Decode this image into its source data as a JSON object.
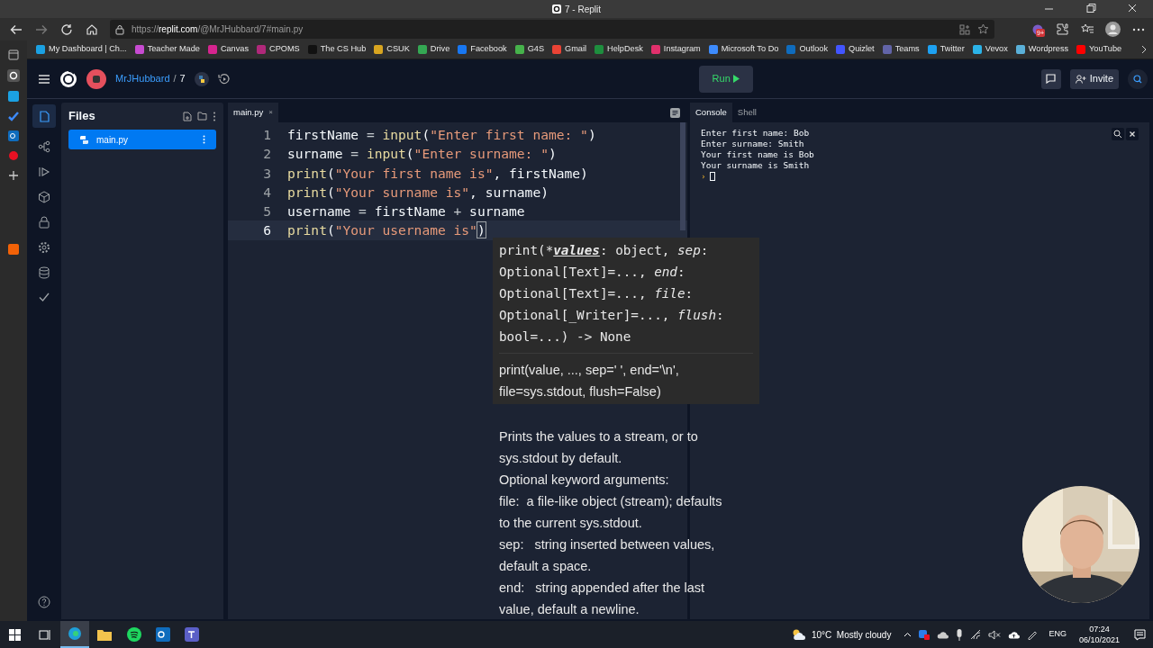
{
  "browser": {
    "tab_title": "7 - Replit",
    "url": {
      "scheme": "https://",
      "host": "replit.com",
      "path": "/@MrJHubbard/7#main.py"
    },
    "extension_badge": "9+",
    "bookmarks": [
      {
        "label": "My Dashboard | Ch...",
        "color": "#1ba1e2"
      },
      {
        "label": "Teacher Made",
        "color": "#c74bd1"
      },
      {
        "label": "Canvas",
        "color": "#d6248f"
      },
      {
        "label": "CPOMS",
        "color": "#b0287a"
      },
      {
        "label": "The CS Hub",
        "color": "#111111"
      },
      {
        "label": "CSUK",
        "color": "#d8a520"
      },
      {
        "label": "Drive",
        "color": "#34a853"
      },
      {
        "label": "Facebook",
        "color": "#1877f2"
      },
      {
        "label": "G4S",
        "color": "#46b24b"
      },
      {
        "label": "Gmail",
        "color": "#ea4335"
      },
      {
        "label": "HelpDesk",
        "color": "#1e8e3e"
      },
      {
        "label": "Instagram",
        "color": "#e1306c"
      },
      {
        "label": "Microsoft To Do",
        "color": "#3d8bfd"
      },
      {
        "label": "Outlook",
        "color": "#0f6cbd"
      },
      {
        "label": "Quizlet",
        "color": "#4255ff"
      },
      {
        "label": "Teams",
        "color": "#6264a7"
      },
      {
        "label": "Twitter",
        "color": "#1da1f2"
      },
      {
        "label": "Vevox",
        "color": "#2bb3e8"
      },
      {
        "label": "Wordpress",
        "color": "#5ab0d8"
      },
      {
        "label": "YouTube",
        "color": "#ff0000"
      }
    ]
  },
  "replit": {
    "user": "MrJHubbard",
    "separator": "/",
    "repl": "7",
    "run_label": "Run",
    "invite_label": "Invite",
    "files_title": "Files",
    "files": [
      {
        "name": "main.py",
        "selected": true
      }
    ],
    "editor_tabs": [
      {
        "label": "main.py",
        "close": "×",
        "selected": true
      }
    ],
    "lines": [
      {
        "number": "1",
        "active": false,
        "tokens": [
          {
            "t": "firstName ",
            "kind": "var"
          },
          {
            "t": "=",
            "kind": "op"
          },
          {
            "t": " input",
            "kind": "fn"
          },
          {
            "t": "(",
            "kind": "punc"
          },
          {
            "t": "\"Enter first name: \"",
            "kind": "str"
          },
          {
            "t": ")",
            "kind": "punc"
          }
        ]
      },
      {
        "number": "2",
        "active": false,
        "tokens": [
          {
            "t": "surname ",
            "kind": "var"
          },
          {
            "t": "=",
            "kind": "op"
          },
          {
            "t": " input",
            "kind": "fn"
          },
          {
            "t": "(",
            "kind": "punc"
          },
          {
            "t": "\"Enter surname: \"",
            "kind": "str"
          },
          {
            "t": ")",
            "kind": "punc"
          }
        ]
      },
      {
        "number": "3",
        "active": false,
        "tokens": [
          {
            "t": "print",
            "kind": "fn"
          },
          {
            "t": "(",
            "kind": "punc"
          },
          {
            "t": "\"Your first name is\"",
            "kind": "str"
          },
          {
            "t": ", firstName)",
            "kind": "punc"
          }
        ]
      },
      {
        "number": "4",
        "active": false,
        "tokens": [
          {
            "t": "print",
            "kind": "fn"
          },
          {
            "t": "(",
            "kind": "punc"
          },
          {
            "t": "\"Your surname is\"",
            "kind": "str"
          },
          {
            "t": ", surname)",
            "kind": "punc"
          }
        ]
      },
      {
        "number": "5",
        "active": false,
        "tokens": [
          {
            "t": "username ",
            "kind": "var"
          },
          {
            "t": "=",
            "kind": "op"
          },
          {
            "t": " firstName ",
            "kind": "var"
          },
          {
            "t": "+",
            "kind": "op"
          },
          {
            "t": " surname",
            "kind": "var"
          }
        ]
      },
      {
        "number": "6",
        "active": true,
        "tokens": [
          {
            "t": "print",
            "kind": "fn"
          },
          {
            "t": "(",
            "kind": "punc"
          },
          {
            "t": "\"Your username is\"",
            "kind": "str"
          },
          {
            "t": ")",
            "kind": "match"
          }
        ]
      }
    ],
    "tooltip": {
      "signature": [
        [
          {
            "t": "print(*",
            "kind": "plain"
          },
          {
            "t": "values",
            "kind": "current"
          },
          {
            "t": ": object, ",
            "kind": "plain"
          },
          {
            "t": "sep",
            "kind": "param"
          },
          {
            "t": ":",
            "kind": "plain"
          }
        ],
        [
          {
            "t": "Optional[Text]=..., ",
            "kind": "plain"
          },
          {
            "t": "end",
            "kind": "param"
          },
          {
            "t": ":",
            "kind": "plain"
          }
        ],
        [
          {
            "t": "Optional[Text]=..., ",
            "kind": "plain"
          },
          {
            "t": "file",
            "kind": "param"
          },
          {
            "t": ":",
            "kind": "plain"
          }
        ],
        [
          {
            "t": "Optional[_Writer]=..., ",
            "kind": "plain"
          },
          {
            "t": "flush",
            "kind": "param"
          },
          {
            "t": ":",
            "kind": "plain"
          }
        ],
        [
          {
            "t": "bool=...) -> None",
            "kind": "plain"
          }
        ]
      ],
      "summary": [
        "print(value, ..., sep=' ', end='\\n',",
        "file=sys.stdout, flush=False)"
      ],
      "doc": [
        "Prints the values to a stream, or to",
        "sys.stdout by default.",
        "Optional keyword arguments:",
        "file:  a file-like object (stream); defaults",
        "to the current sys.stdout.",
        "sep:   string inserted between values,",
        "default a space.",
        "end:   string appended after the last",
        "value, default a newline."
      ]
    },
    "console_tabs": [
      {
        "label": "Console",
        "selected": true
      },
      {
        "label": "Shell",
        "selected": false
      }
    ],
    "console_output": [
      "Enter first name: Bob",
      "Enter surname: Smith",
      "Your first name is Bob",
      "Your surname is Smith"
    ],
    "prompt": "›"
  },
  "taskbar": {
    "weather": "10°C  Mostly cloudy",
    "language": "ENG",
    "time": "07:24",
    "date": "06/10/2021"
  }
}
